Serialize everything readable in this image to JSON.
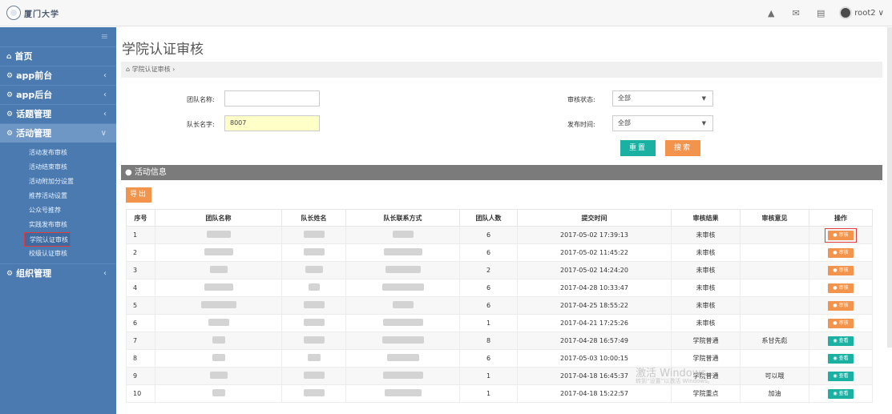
{
  "topbar": {
    "logo_text": "厦门大学",
    "icons": [
      "warning-icon",
      "mail-icon",
      "message-icon"
    ],
    "user_name": "root2",
    "user_caret": "∨"
  },
  "sidebar": {
    "toggle": "≡",
    "items": [
      {
        "label": "首页",
        "icon": "home-icon",
        "arrow": ""
      },
      {
        "label": "app前台",
        "icon": "gears-icon",
        "arrow": "‹"
      },
      {
        "label": "app后台",
        "icon": "gears-icon",
        "arrow": "‹"
      },
      {
        "label": "话题管理",
        "icon": "gears-icon",
        "arrow": "‹"
      },
      {
        "label": "活动管理",
        "icon": "gears-icon",
        "arrow": "∨"
      }
    ],
    "subitems": [
      "活动发布审核",
      "活动结束审核",
      "活动附加分设置",
      "推荐活动设置",
      "公众号推荐",
      "实践发布审核",
      "学院认证审核",
      "校级认证审核"
    ],
    "current_subitem": "学院认证审核",
    "last_item": {
      "label": "组织管理",
      "icon": "gears-icon",
      "arrow": "‹"
    }
  },
  "main": {
    "title": "学院认证审核",
    "breadcrumb": "学院认证审核 ›",
    "form": {
      "team_name_label": "团队名称:",
      "team_name_value": "",
      "leader_label": "队长名字:",
      "leader_value": "8007",
      "status_label": "审核状态:",
      "status_value": "全部",
      "time_label": "发布时间:",
      "time_value": "全部",
      "reset_label": "重置",
      "search_label": "搜索"
    },
    "section_title": "活动信息",
    "export_label": "导出",
    "table": {
      "headers": [
        "序号",
        "团队名称",
        "队长姓名",
        "队长联系方式",
        "团队人数",
        "提交时间",
        "审核结果",
        "审核意见",
        "操作"
      ],
      "rows": [
        {
          "no": "1",
          "count": "6",
          "time": "2017-05-02 17:39:13",
          "result": "未审核",
          "opinion": "",
          "action": "审核",
          "type": "review"
        },
        {
          "no": "2",
          "count": "6",
          "time": "2017-05-02 11:45:22",
          "result": "未审核",
          "opinion": "",
          "action": "审核",
          "type": "review"
        },
        {
          "no": "3",
          "count": "2",
          "time": "2017-05-02 14:24:20",
          "result": "未审核",
          "opinion": "",
          "action": "审核",
          "type": "review"
        },
        {
          "no": "4",
          "count": "6",
          "time": "2017-04-28 10:33:47",
          "result": "未审核",
          "opinion": "",
          "action": "审核",
          "type": "review"
        },
        {
          "no": "5",
          "count": "6",
          "time": "2017-04-25 18:55:22",
          "result": "未审核",
          "opinion": "",
          "action": "审核",
          "type": "review"
        },
        {
          "no": "6",
          "count": "1",
          "time": "2017-04-21 17:25:26",
          "result": "未审核",
          "opinion": "",
          "action": "审核",
          "type": "review"
        },
        {
          "no": "7",
          "count": "8",
          "time": "2017-04-28 16:57:49",
          "result": "学院普通",
          "opinion": "系甘先彪",
          "action": "查看",
          "type": "view"
        },
        {
          "no": "8",
          "count": "6",
          "time": "2017-05-03 10:00:15",
          "result": "学院普通",
          "opinion": "",
          "action": "查看",
          "type": "view"
        },
        {
          "no": "9",
          "count": "1",
          "time": "2017-04-18 16:45:37",
          "result": "学院普通",
          "opinion": "可以哦",
          "action": "查看",
          "type": "view"
        },
        {
          "no": "10",
          "count": "1",
          "time": "2017-04-18 15:22:57",
          "result": "学院重点",
          "opinion": "加油",
          "action": "查看",
          "type": "view"
        }
      ]
    },
    "watermark_line1": "激活 Windows",
    "watermark_line2": "转到“设置”以激活 Windows。"
  }
}
